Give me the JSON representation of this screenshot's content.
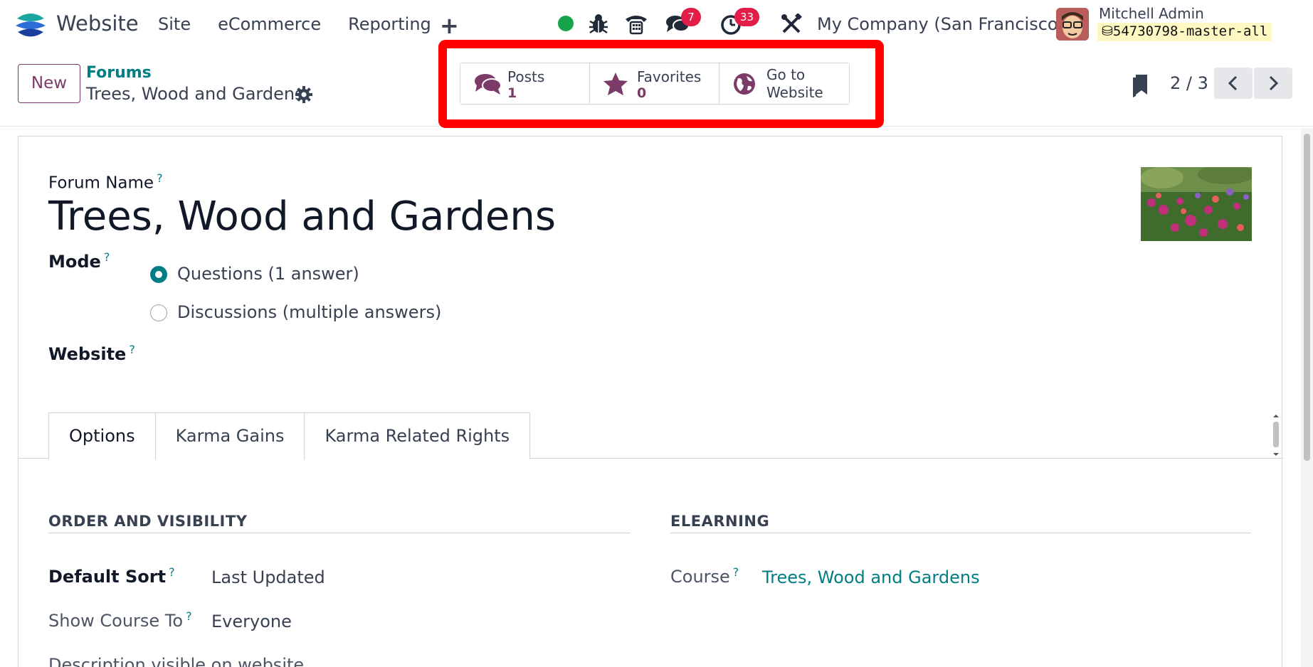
{
  "navbar": {
    "app_name": "Website",
    "menu": [
      "Site",
      "eCommerce",
      "Reporting"
    ],
    "plus_label": "+",
    "messages_count": "7",
    "activities_count": "33",
    "company": "My Company (San Francisco)",
    "user_name": "Mitchell Admin",
    "database": "54730798-master-all"
  },
  "control": {
    "new_label": "New",
    "breadcrumb_parent": "Forums",
    "breadcrumb_current": "Trees, Wood and Gardens",
    "pager": "2 / 3"
  },
  "smart_buttons": {
    "posts_label": "Posts",
    "posts_value": "1",
    "favorites_label": "Favorites",
    "favorites_value": "0",
    "website_label_1": "Go to",
    "website_label_2": "Website"
  },
  "form": {
    "forum_name_label": "Forum Name",
    "forum_name": "Trees, Wood and Gardens",
    "mode_label": "Mode",
    "mode_option_1": "Questions (1 answer)",
    "mode_option_2": "Discussions (multiple answers)",
    "mode_selected": "Questions (1 answer)",
    "website_label": "Website",
    "help_mark": "?"
  },
  "tabs": [
    "Options",
    "Karma Gains",
    "Karma Related Rights"
  ],
  "options": {
    "section_left": "ORDER AND VISIBILITY",
    "section_right": "ELEARNING",
    "default_sort_label": "Default Sort",
    "default_sort_value": "Last Updated",
    "show_course_label": "Show Course To",
    "show_course_value": "Everyone",
    "description_label": "Description visible on website",
    "course_label": "Course",
    "course_value": "Trees, Wood and Gardens"
  },
  "colors": {
    "brand_purple": "#7c3a69",
    "accent_teal": "#017e84",
    "badge_red": "#e11d48",
    "highlight_red": "#ff0000"
  }
}
